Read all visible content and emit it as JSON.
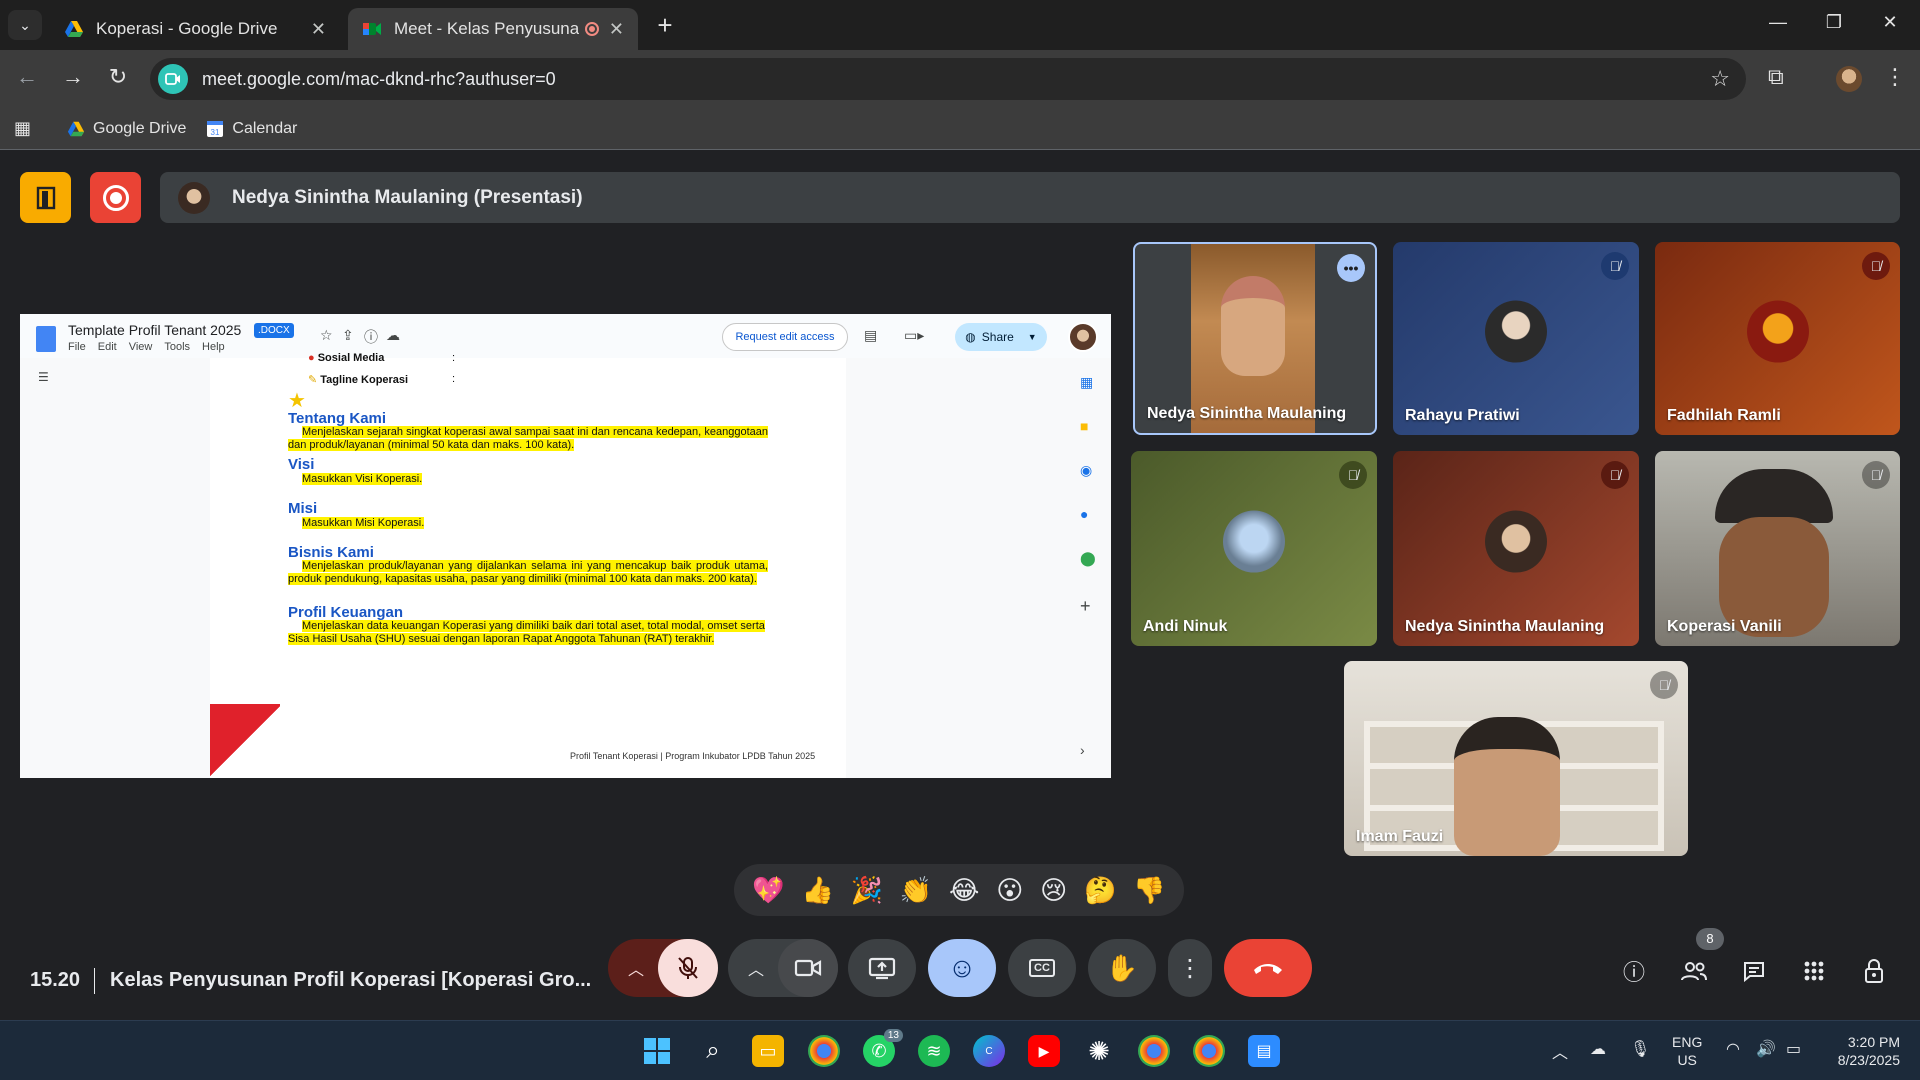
{
  "browser": {
    "tabs": [
      {
        "title": "Koperasi - Google Drive",
        "active": false
      },
      {
        "title": "Meet - Kelas Penyusunan Pr",
        "active": true
      }
    ],
    "url": "meet.google.com/mac-dknd-rhc?authuser=0",
    "bookmarks": [
      {
        "label": "Google Drive",
        "icon": "google-drive-icon"
      },
      {
        "label": "Calendar",
        "icon": "calendar-icon"
      }
    ]
  },
  "meet": {
    "presenting_banner": "Nedya Sinintha Maulaning (Presentasi)",
    "clock": "15.20",
    "meeting_title": "Kelas Penyusunan Profil Koperasi [Koperasi Gro...",
    "participant_count": "8",
    "reactions": [
      "💖",
      "👍",
      "🎉",
      "👏",
      "😂",
      "😮",
      "😢",
      "🤔",
      "👎"
    ]
  },
  "shared_doc": {
    "title": "Template Profil Tenant 2025",
    "badge": ".DOCX",
    "menu": [
      "File",
      "Edit",
      "View",
      "Tools",
      "Help"
    ],
    "request_button": "Request edit access",
    "share_button": "Share",
    "lines": {
      "sosial_media": "Sosial Media",
      "tagline": "Tagline Koperasi",
      "colon": ":"
    },
    "sections": [
      {
        "heading": "Tentang Kami",
        "body": "Menjelaskan sejarah singkat koperasi awal sampai saat ini dan rencana kedepan, keanggotaan dan produk/layanan (minimal 50 kata dan maks. 100 kata)."
      },
      {
        "heading": "Visi",
        "body": "Masukkan Visi Koperasi."
      },
      {
        "heading": "Misi",
        "body": "Masukkan Misi Koperasi."
      },
      {
        "heading": "Bisnis Kami",
        "body": "Menjelaskan produk/layanan yang dijalankan selama ini yang mencakup baik produk utama, produk pendukung, kapasitas usaha, pasar yang dimiliki (minimal 100 kata dan maks. 200 kata)."
      },
      {
        "heading": "Profil Keuangan",
        "body": "Menjelaskan data keuangan Koperasi yang dimiliki baik dari total aset, total modal, omset serta Sisa Hasil Usaha (SHU) sesuai dengan laporan Rapat Anggota Tahunan (RAT) terakhir."
      }
    ],
    "footer": "Profil Tenant Koperasi  |  Program Inkubator LPDB Tahun 2025"
  },
  "participants": [
    {
      "name": "Nedya Sinintha Maulaning",
      "muted": false
    },
    {
      "name": "Rahayu Pratiwi",
      "muted": true
    },
    {
      "name": "Fadhilah Ramli",
      "muted": true
    },
    {
      "name": "Andi Ninuk",
      "muted": true
    },
    {
      "name": "Nedya Sinintha Maulaning",
      "muted": true
    },
    {
      "name": "Koperasi Vanili",
      "muted": true
    },
    {
      "name": "Imam Fauzi",
      "muted": true
    }
  ],
  "taskbar": {
    "whatsapp_badge": "13",
    "language": "ENG",
    "region": "US",
    "time": "3:20 PM",
    "date": "8/23/2025"
  },
  "colors": {
    "meet_bg": "#202124",
    "end_call": "#ea4335",
    "mic_off_bg": "#f9dedc",
    "accent_yellow": "#f9ab00",
    "record_red": "#ea4335",
    "reactions_active": "#a8c7fa"
  }
}
